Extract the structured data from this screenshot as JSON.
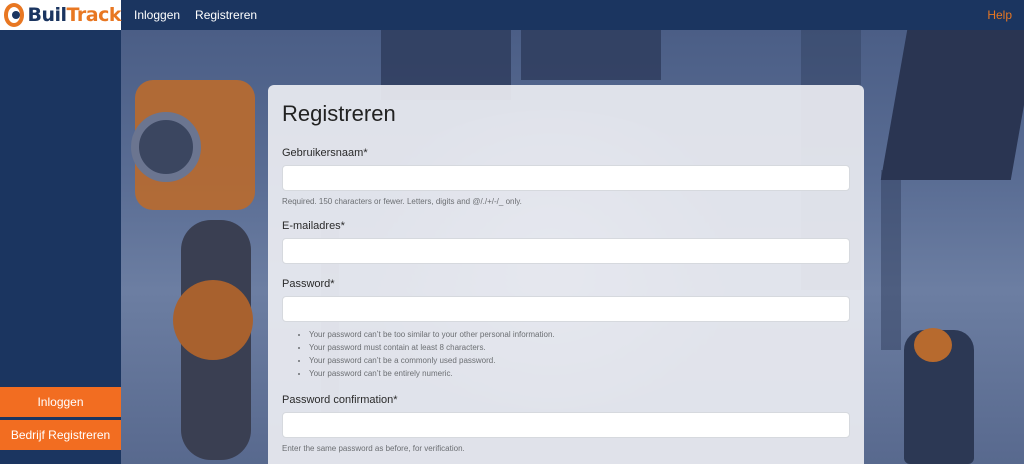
{
  "brand": {
    "part1": "Buil",
    "part2": "Track"
  },
  "topnav": {
    "login": "Inloggen",
    "register": "Registreren",
    "help": "Help"
  },
  "sidebar": {
    "login": "Inloggen",
    "company_register": "Bedrijf Registreren"
  },
  "form": {
    "title": "Registreren",
    "username": {
      "label": "Gebruikersnaam*",
      "value": "",
      "help": "Required. 150 characters or fewer. Letters, digits and @/./+/-/_ only."
    },
    "email": {
      "label": "E-mailadres*",
      "value": ""
    },
    "password": {
      "label": "Password*",
      "value": "",
      "hints": [
        "Your password can’t be too similar to your other personal information.",
        "Your password must contain at least 8 characters.",
        "Your password can’t be a commonly used password.",
        "Your password can’t be entirely numeric."
      ]
    },
    "password_confirmation": {
      "label": "Password confirmation*",
      "value": "",
      "help": "Enter the same password as before, for verification."
    }
  },
  "colors": {
    "navy": "#1b3560",
    "orange": "#f26d21",
    "brand_orange": "#e87722"
  }
}
